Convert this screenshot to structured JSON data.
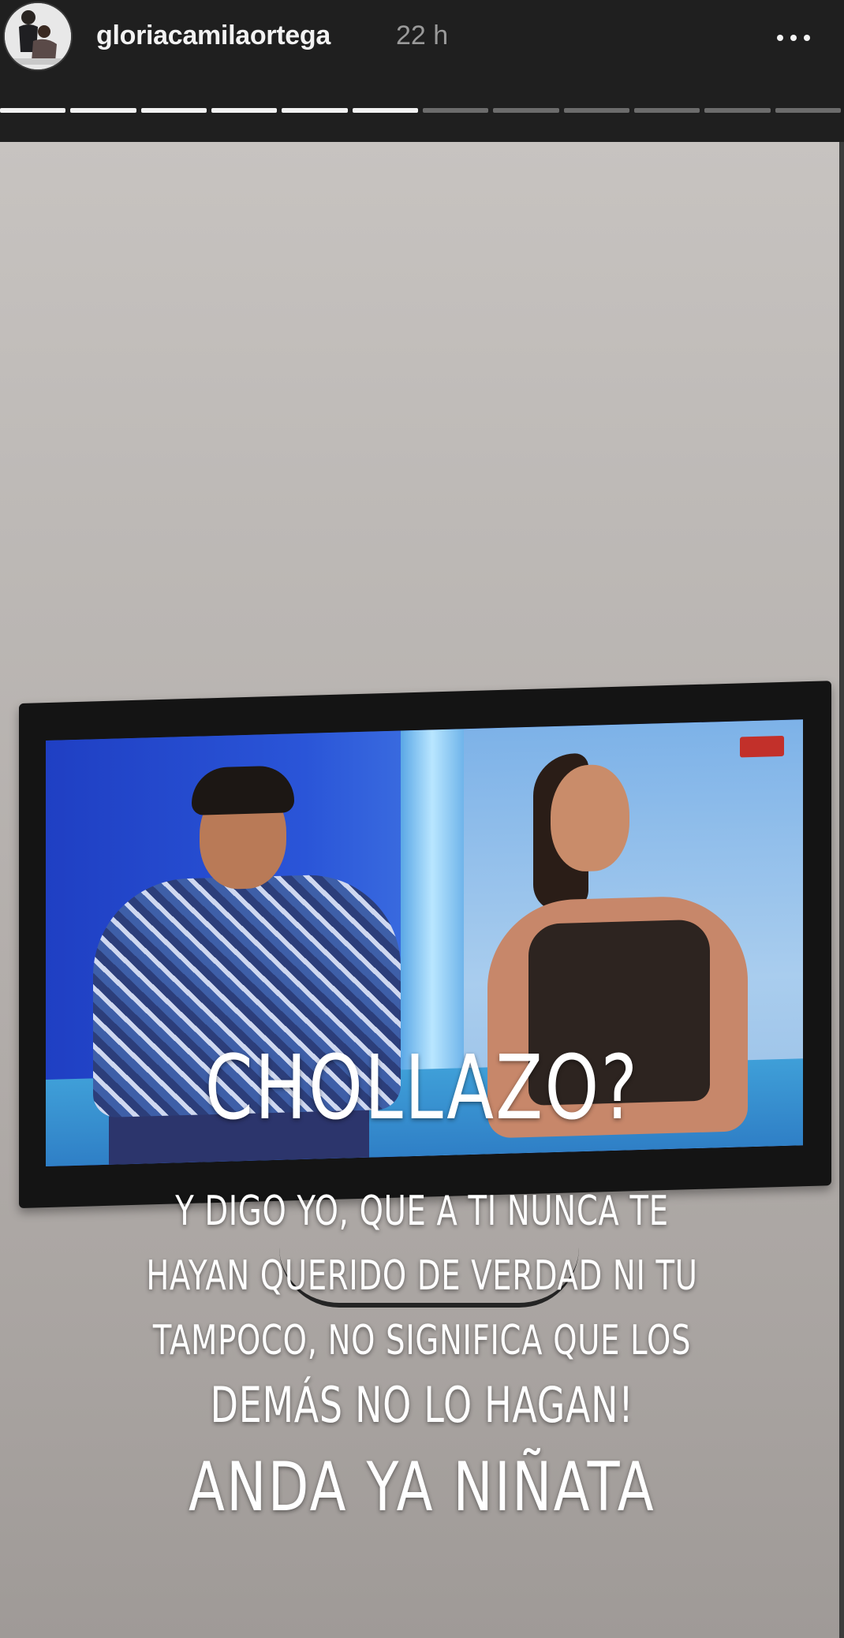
{
  "story": {
    "username": "gloriacamilaortega",
    "timestamp": "22 h",
    "progress_total": 12,
    "progress_completed": 6
  },
  "overlay": {
    "headline": "CHOLLAZO?",
    "lines": [
      "Y DIGO YO, QUE A TI NUNCA TE",
      "HAYAN QUERIDO DE VERDAD NI TU",
      "TAMPOCO, NO SIGNIFICA QUE LOS",
      "DEMÁS NO LO HAGAN!"
    ],
    "closer": "ANDA YA NIÑATA"
  },
  "icons": {
    "more": "more-options-icon",
    "avatar": "profile-avatar"
  },
  "colors": {
    "header_bg": "#1f1f1f",
    "progress_done": "#f1f1f1",
    "progress_pending": "#6c6c6c",
    "wall": "#bdb9b6",
    "text": "#ffffff"
  }
}
